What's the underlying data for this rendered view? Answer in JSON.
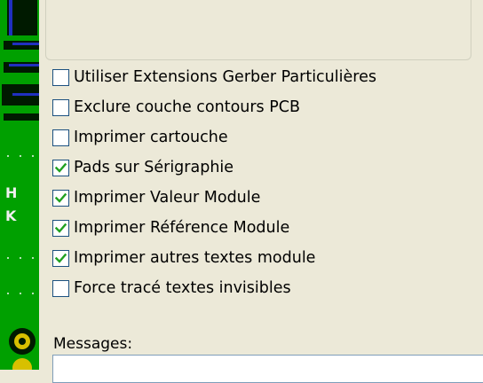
{
  "options": [
    {
      "label": "Utiliser Extensions Gerber Particulières",
      "checked": false
    },
    {
      "label": "Exclure couche contours PCB",
      "checked": false
    },
    {
      "label": "Imprimer cartouche",
      "checked": false
    },
    {
      "label": "Pads sur Sérigraphie",
      "checked": true
    },
    {
      "label": "Imprimer Valeur Module",
      "checked": true
    },
    {
      "label": "Imprimer Référence Module",
      "checked": true
    },
    {
      "label": "Imprimer autres textes  module",
      "checked": true
    },
    {
      "label": "Force tracé textes invisibles",
      "checked": false
    }
  ],
  "messages": {
    "label": "Messages:",
    "value": ""
  },
  "colors": {
    "checkmark": "#21a121",
    "checkbox_border": "#1c5180",
    "panel_bg": "#ece9d8",
    "pcb_green": "#00a000"
  }
}
